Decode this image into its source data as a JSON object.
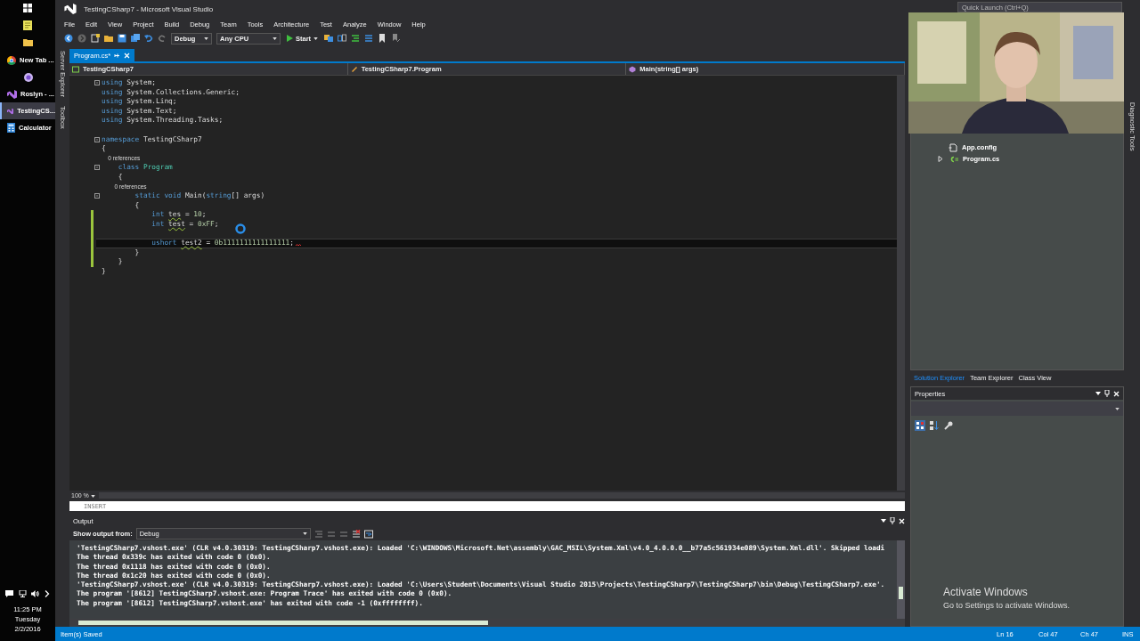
{
  "taskbar": {
    "items": [
      {
        "kind": "browser",
        "label": "New Tab ...",
        "selected": false
      },
      {
        "kind": "circle",
        "selected": false
      },
      {
        "kind": "vs",
        "label": "Roslyn - ...",
        "selected": false
      },
      {
        "kind": "vs",
        "label": "TestingCS...",
        "selected": true
      },
      {
        "kind": "calculator",
        "label": "Calculator",
        "selected": false
      }
    ],
    "clock": {
      "time": "11:25 PM",
      "day": "Tuesday",
      "date": "2/2/2016"
    }
  },
  "window": {
    "title": "TestingCSharp7 - Microsoft Visual Studio",
    "quick_launch_placeholder": "Quick Launch (Ctrl+Q)"
  },
  "menu": [
    "File",
    "Edit",
    "View",
    "Project",
    "Build",
    "Debug",
    "Team",
    "Tools",
    "Architecture",
    "Test",
    "Analyze",
    "Window",
    "Help"
  ],
  "toolbar": {
    "configuration": "Debug",
    "platform": "Any CPU",
    "start": "Start"
  },
  "side_tabs_left": [
    "Server Explorer",
    "Toolbox"
  ],
  "side_tabs_right": [
    "Diagnostic Tools"
  ],
  "document_tabs": [
    {
      "label": "Program.cs*",
      "selected": true
    }
  ],
  "nav_bar": [
    "TestingCSharp7",
    "TestingCSharp7.Program",
    "Main(string[] args)"
  ],
  "code_lines": [
    {
      "kind": "code",
      "fold": true,
      "tokens": [
        {
          "t": "using",
          "kind": "keyword"
        },
        {
          "t": " System;",
          "kind": "plain"
        }
      ]
    },
    {
      "kind": "code",
      "tokens": [
        {
          "t": "using",
          "kind": "keyword"
        },
        {
          "t": " System.Collections.Generic;",
          "kind": "plain"
        }
      ]
    },
    {
      "kind": "code",
      "tokens": [
        {
          "t": "using",
          "kind": "keyword"
        },
        {
          "t": " System.Linq;",
          "kind": "plain"
        }
      ]
    },
    {
      "kind": "code",
      "tokens": [
        {
          "t": "using",
          "kind": "keyword"
        },
        {
          "t": " System.Text;",
          "kind": "plain"
        }
      ]
    },
    {
      "kind": "code",
      "tokens": [
        {
          "t": "using",
          "kind": "keyword"
        },
        {
          "t": " System.Threading.Tasks;",
          "kind": "plain"
        }
      ]
    },
    {
      "kind": "blank"
    },
    {
      "kind": "code",
      "fold": true,
      "tokens": [
        {
          "t": "namespace",
          "kind": "keyword"
        },
        {
          "t": " TestingCSharp7",
          "kind": "plain"
        }
      ]
    },
    {
      "kind": "code",
      "tokens": [
        {
          "t": "{",
          "kind": "plain"
        }
      ]
    },
    {
      "kind": "lens",
      "tokens": [
        {
          "t": "    0 references",
          "kind": "plain"
        }
      ]
    },
    {
      "kind": "code",
      "fold": true,
      "tokens": [
        {
          "t": "    class ",
          "kind": "keyword"
        },
        {
          "t": "Program",
          "kind": "type"
        }
      ]
    },
    {
      "kind": "code",
      "tokens": [
        {
          "t": "    {",
          "kind": "plain"
        }
      ]
    },
    {
      "kind": "lens",
      "tokens": [
        {
          "t": "        0 references",
          "kind": "plain"
        }
      ]
    },
    {
      "kind": "code",
      "fold": true,
      "tokens": [
        {
          "t": "        static void",
          "kind": "keyword"
        },
        {
          "t": " Main(",
          "kind": "plain"
        },
        {
          "t": "string",
          "kind": "keyword"
        },
        {
          "t": "[] args)",
          "kind": "plain"
        }
      ]
    },
    {
      "kind": "code",
      "tokens": [
        {
          "t": "        {",
          "kind": "plain"
        }
      ]
    },
    {
      "kind": "code",
      "changed": true,
      "tokens": [
        {
          "t": "            int ",
          "kind": "keyword"
        },
        {
          "t": "tes",
          "kind": "plain",
          "squiggle": true
        },
        {
          "t": " = ",
          "kind": "plain"
        },
        {
          "t": "10",
          "kind": "number"
        },
        {
          "t": ";",
          "kind": "plain"
        }
      ]
    },
    {
      "kind": "code",
      "changed": true,
      "tokens": [
        {
          "t": "            int ",
          "kind": "keyword"
        },
        {
          "t": "test",
          "kind": "plain",
          "squiggle": true
        },
        {
          "t": " = ",
          "kind": "plain"
        },
        {
          "t": "0xFF",
          "kind": "number"
        },
        {
          "t": ";",
          "kind": "plain"
        }
      ]
    },
    {
      "kind": "blank",
      "changed": true
    },
    {
      "kind": "code",
      "changed": true,
      "current": true,
      "error": true,
      "tokens": [
        {
          "t": "            ushort ",
          "kind": "keyword"
        },
        {
          "t": "test2",
          "kind": "plain",
          "squiggle": true
        },
        {
          "t": " = ",
          "kind": "plain"
        },
        {
          "t": "0b1111111111111111",
          "kind": "number"
        },
        {
          "t": ";",
          "kind": "plain"
        }
      ]
    },
    {
      "kind": "code",
      "changed": true,
      "tokens": [
        {
          "t": "        }",
          "kind": "plain"
        }
      ]
    },
    {
      "kind": "code",
      "changed": true,
      "tokens": [
        {
          "t": "    }",
          "kind": "plain"
        }
      ]
    },
    {
      "kind": "code",
      "tokens": [
        {
          "t": "}",
          "kind": "plain"
        }
      ]
    }
  ],
  "editor": {
    "zoom": "100 %",
    "mode": "INSERT"
  },
  "output": {
    "title": "Output",
    "source_label": "Show output from:",
    "source": "Debug",
    "lines": [
      "'TestingCSharp7.vshost.exe' (CLR v4.0.30319: TestingCSharp7.vshost.exe): Loaded 'C:\\WINDOWS\\Microsoft.Net\\assembly\\GAC_MSIL\\System.Xml\\v4.0_4.0.0.0__b77a5c561934e089\\System.Xml.dll'. Skipped loadi",
      "The thread 0x339c has exited with code 0 (0x0).",
      "The thread 0x1118 has exited with code 0 (0x0).",
      "The thread 0x1c20 has exited with code 0 (0x0).",
      "'TestingCSharp7.vshost.exe' (CLR v4.0.30319: TestingCSharp7.vshost.exe): Loaded 'C:\\Users\\Student\\Documents\\Visual Studio 2015\\Projects\\TestingCSharp7\\TestingCSharp7\\bin\\Debug\\TestingCSharp7.exe'.",
      "The program '[8612] TestingCSharp7.vshost.exe: Program Trace' has exited with code 0 (0x0).",
      "The program '[8612] TestingCSharp7.vshost.exe' has exited with code -1 (0xffffffff)."
    ]
  },
  "solution_explorer": {
    "items": [
      {
        "kind": "config",
        "label": "App.config"
      },
      {
        "kind": "csharp",
        "label": "Program.cs",
        "expanded": false
      }
    ]
  },
  "panel_tabs": [
    {
      "label": "Solution Explorer",
      "selected": true
    },
    {
      "label": "Team Explorer",
      "selected": false
    },
    {
      "label": "Class View",
      "selected": false
    }
  ],
  "properties": {
    "title": "Properties"
  },
  "activation": {
    "title": "Activate Windows",
    "hint": "Go to Settings to activate Windows."
  },
  "status_bar": {
    "message": "Item(s) Saved",
    "line": "Ln 16",
    "column": "Col 47",
    "char": "Ch 47",
    "mode": "INS"
  },
  "webcam": {
    "kind": "picture"
  }
}
